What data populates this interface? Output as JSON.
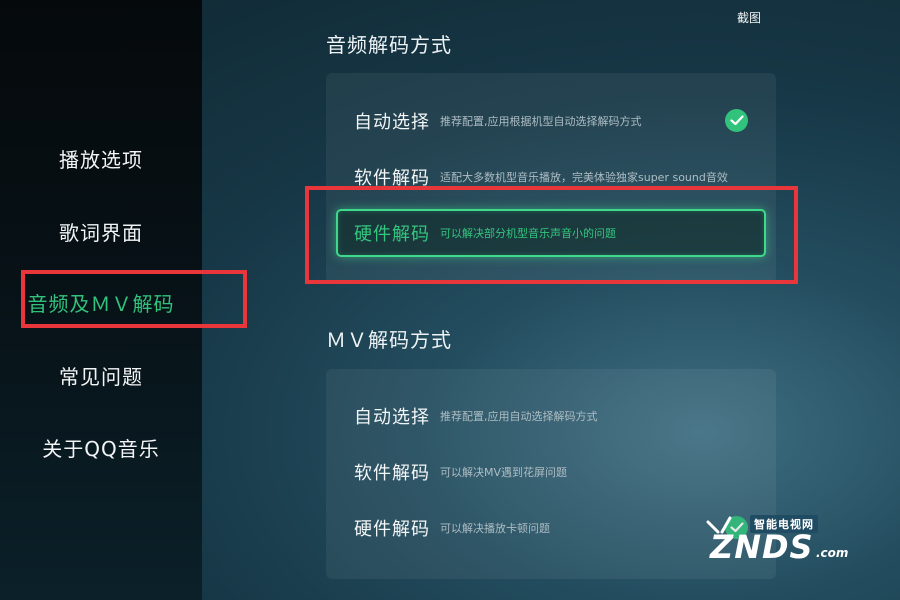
{
  "sidebar": {
    "items": [
      {
        "label": "播放选项"
      },
      {
        "label": "歌词界面"
      },
      {
        "label": "音频及ＭＶ解码",
        "active": true
      },
      {
        "label": "常见问题"
      },
      {
        "label": "关于QQ音乐"
      }
    ]
  },
  "screenshot_label": "截图",
  "audio_section": {
    "title": "音频解码方式",
    "options": [
      {
        "label": "自动选择",
        "desc": "推荐配置,应用根据机型自动选择解码方式",
        "checked": true
      },
      {
        "label": "软件解码",
        "desc": "适配大多数机型音乐播放，完美体验独家super sound音效"
      },
      {
        "label": "硬件解码",
        "desc": "可以解决部分机型音乐声音小的问题",
        "focused": true
      }
    ]
  },
  "mv_section": {
    "title": "ＭＶ解码方式",
    "options": [
      {
        "label": "自动选择",
        "desc": "推荐配置,应用自动选择解码方式"
      },
      {
        "label": "软件解码",
        "desc": "可以解决MV遇到花屏问题"
      },
      {
        "label": "硬件解码",
        "desc": "可以解决播放卡顿问题",
        "checked": true
      }
    ]
  },
  "watermark": {
    "top": "智能电视网",
    "main": "ZNDS",
    "suffix": ".com"
  },
  "colors": {
    "accent": "#31c27c",
    "highlight_box": "#e8363a"
  }
}
